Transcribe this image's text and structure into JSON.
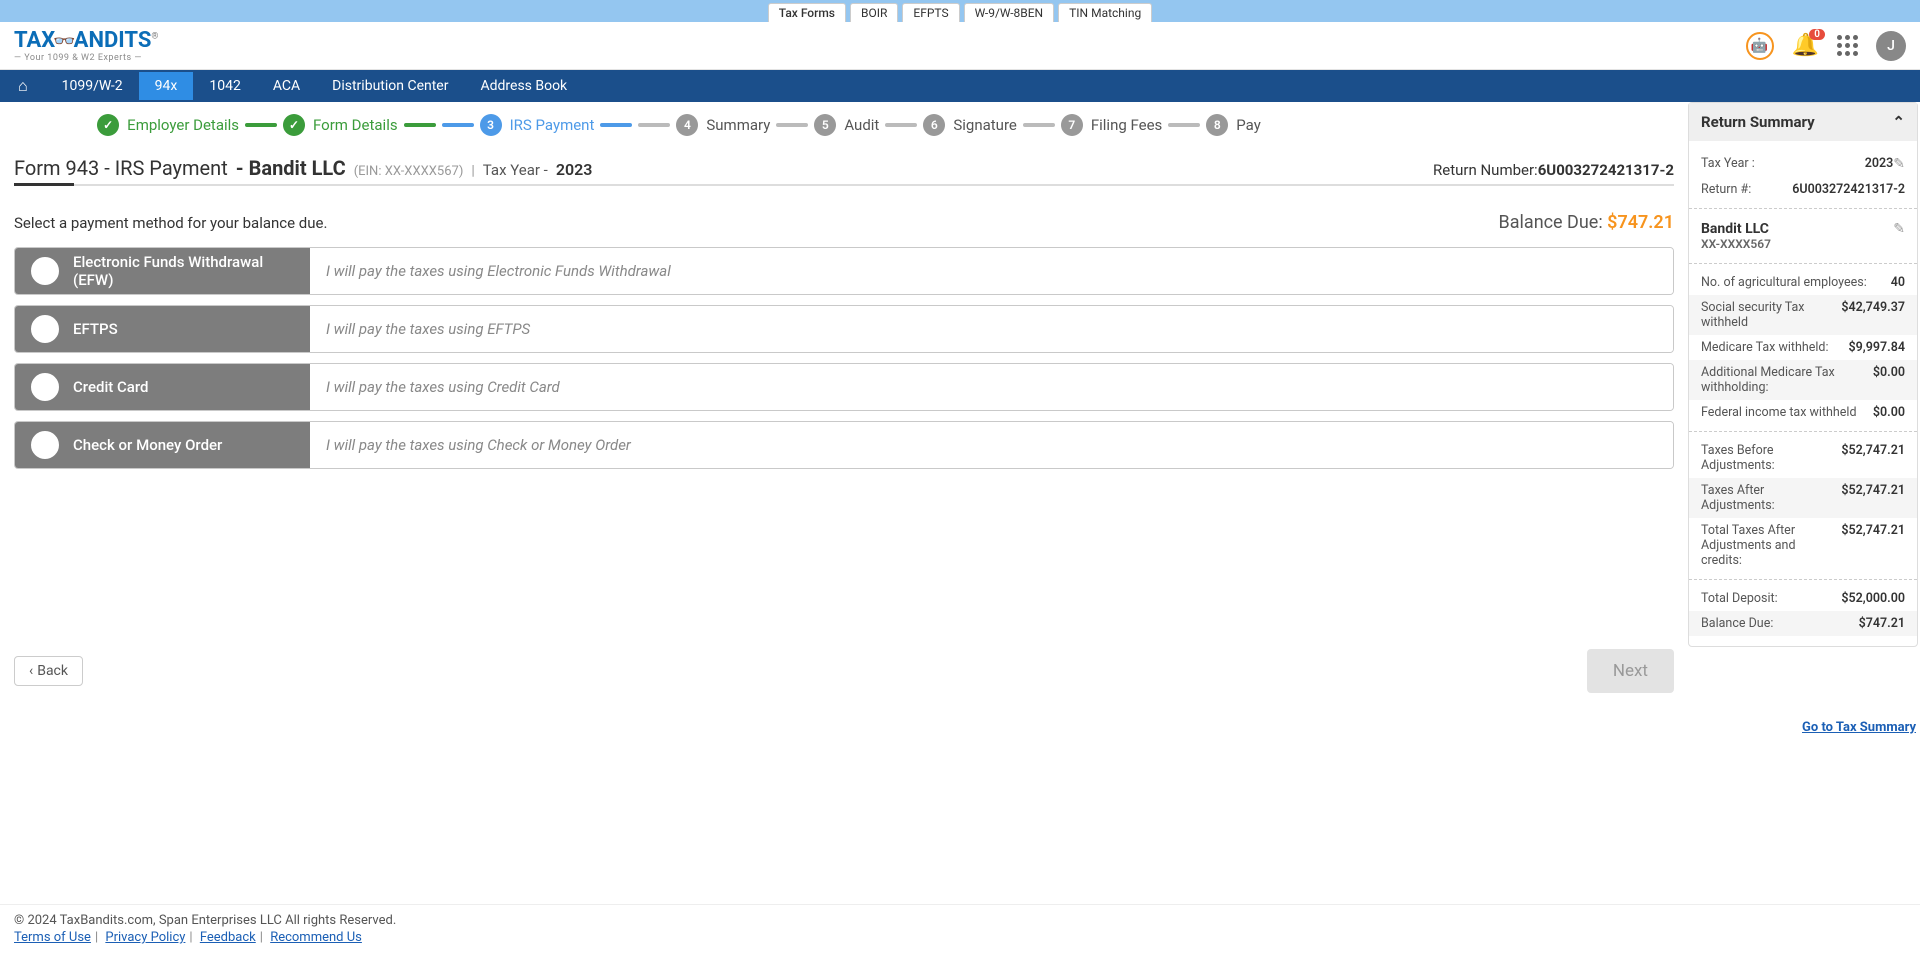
{
  "top_tabs": [
    "Tax Forms",
    "BOIR",
    "EFPTS",
    "W-9/W-8BEN",
    "TIN Matching"
  ],
  "logo": {
    "tax": "TAX",
    "bandits": "ANDITS",
    "tagline": "— Your 1099 & W2 Experts —",
    "reg": "®"
  },
  "notifications": {
    "count": "0"
  },
  "avatar_letter": "J",
  "nav": [
    "1099/W-2",
    "94x",
    "1042",
    "ACA",
    "Distribution Center",
    "Address Book"
  ],
  "nav_active": "94x",
  "steps": [
    {
      "label": "Employer Details",
      "state": "done"
    },
    {
      "label": "Form Details",
      "state": "done"
    },
    {
      "num": "3",
      "label": "IRS Payment",
      "state": "current"
    },
    {
      "num": "4",
      "label": "Summary",
      "state": "pending"
    },
    {
      "num": "5",
      "label": "Audit",
      "state": "pending"
    },
    {
      "num": "6",
      "label": "Signature",
      "state": "pending"
    },
    {
      "num": "7",
      "label": "Filing Fees",
      "state": "pending"
    },
    {
      "num": "8",
      "label": "Pay",
      "state": "pending"
    }
  ],
  "page": {
    "title": "Form 943 - IRS Payment",
    "dash": " - ",
    "business": "Bandit LLC",
    "ein": "(EIN: XX-XXXX567)",
    "pipe": "|",
    "tax_year_label": "Tax Year  - ",
    "tax_year": "2023",
    "return_num_label": "Return Number:",
    "return_num": "6U003272421317-2"
  },
  "balance": {
    "select_text": "Select a payment method for your balance due.",
    "label": "Balance Due: ",
    "amount": "$747.21"
  },
  "options": [
    {
      "name": "Electronic Funds Withdrawal (EFW)",
      "desc": "I will pay the taxes using Electronic Funds Withdrawal"
    },
    {
      "name": "EFTPS",
      "desc": "I will pay the taxes using EFTPS"
    },
    {
      "name": "Credit Card",
      "desc": "I will pay the taxes using Credit Card"
    },
    {
      "name": "Check or Money Order",
      "desc": "I will pay the taxes using Check or Money Order"
    }
  ],
  "buttons": {
    "back": "Back",
    "next": "Next"
  },
  "summary": {
    "title": "Return Summary",
    "tax_year_label": "Tax Year :",
    "tax_year": "2023",
    "return_label": "Return #:",
    "return_num": "6U003272421317-2",
    "biz_name": "Bandit LLC",
    "biz_ein": "XX-XXXX567",
    "rows": [
      {
        "label": "No. of agricultural employees:",
        "value": "40",
        "alt": false
      },
      {
        "label": "Social security Tax withheld",
        "value": "$42,749.37",
        "alt": true
      },
      {
        "label": "Medicare Tax withheld:",
        "value": "$9,997.84",
        "alt": false
      },
      {
        "label": "Additional Medicare Tax withholding:",
        "value": "$0.00",
        "alt": true
      },
      {
        "label": "Federal income tax withheld",
        "value": "$0.00",
        "alt": false
      }
    ],
    "rows2": [
      {
        "label": "Taxes Before Adjustments:",
        "value": "$52,747.21",
        "alt": false
      },
      {
        "label": "Taxes After Adjustments:",
        "value": "$52,747.21",
        "alt": true
      },
      {
        "label": "Total Taxes After Adjustments and credits:",
        "value": "$52,747.21",
        "alt": false
      }
    ],
    "rows3": [
      {
        "label": "Total Deposit:",
        "value": "$52,000.00",
        "alt": false
      },
      {
        "label": "Balance Due:",
        "value": "$747.21",
        "alt": true
      }
    ],
    "goto": "Go to Tax Summary"
  },
  "footer": {
    "copyright": "© 2024 TaxBandits.com, Span Enterprises LLC All rights Reserved.",
    "links": [
      "Terms of Use",
      "Privacy Policy",
      "Feedback",
      "Recommend Us"
    ]
  }
}
